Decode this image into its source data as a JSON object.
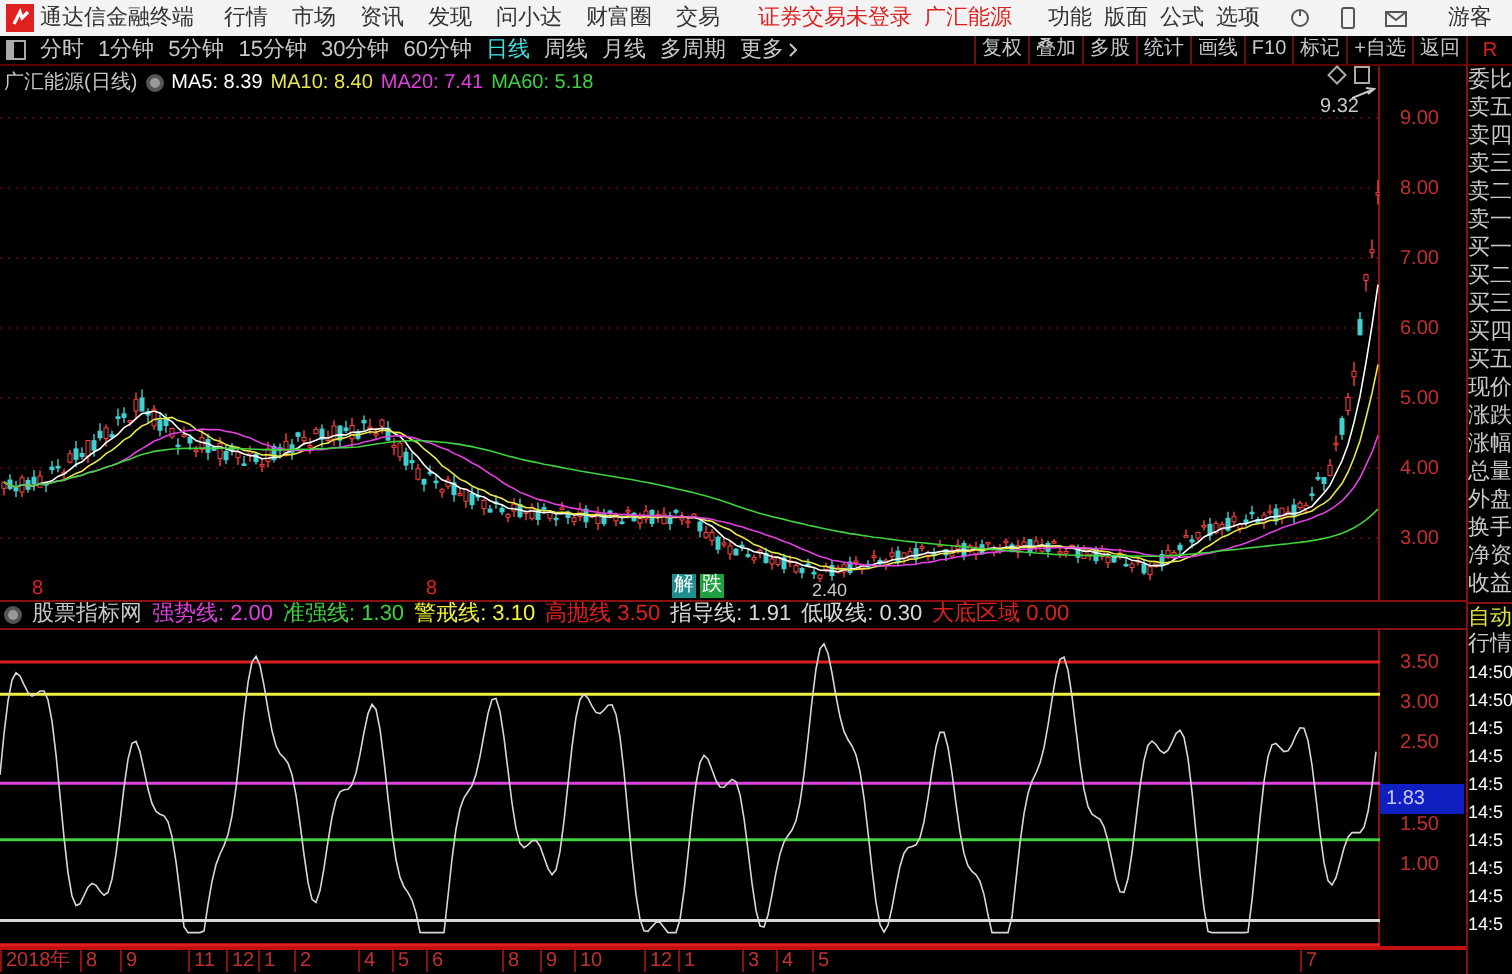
{
  "app_menu": {
    "title": "通达信金融终端",
    "items": [
      "行情",
      "市场",
      "资讯",
      "发现",
      "问小达",
      "财富圈",
      "交易"
    ],
    "notice": "证券交易未登录",
    "stock_link": "广汇能源",
    "tools": [
      "功能",
      "版面",
      "公式",
      "选项"
    ],
    "user": "游客"
  },
  "period_tabs": [
    {
      "label": "分时",
      "selected": false
    },
    {
      "label": "1分钟",
      "selected": false
    },
    {
      "label": "5分钟",
      "selected": false
    },
    {
      "label": "15分钟",
      "selected": false
    },
    {
      "label": "30分钟",
      "selected": false
    },
    {
      "label": "60分钟",
      "selected": false
    },
    {
      "label": "日线",
      "selected": true
    },
    {
      "label": "周线",
      "selected": false
    },
    {
      "label": "月线",
      "selected": false
    },
    {
      "label": "多周期",
      "selected": false
    },
    {
      "label": "更多",
      "selected": false
    }
  ],
  "chart_tools": [
    "复权",
    "叠加",
    "多股",
    "统计",
    "画线",
    "F10",
    "标记",
    "+自选",
    "返回"
  ],
  "corner_mark": "R",
  "price_chart": {
    "title": "广汇能源(日线)",
    "ma": [
      {
        "label": "MA5: 8.39",
        "color": "#ffffff"
      },
      {
        "label": "MA10: 8.40",
        "color": "#e8e84a"
      },
      {
        "label": "MA20: 7.41",
        "color": "#e040e0"
      },
      {
        "label": "MA60: 5.18",
        "color": "#40d040"
      }
    ],
    "high_label": "9.32",
    "low_label": "2.40",
    "axis": [
      "9.00",
      "8.00",
      "7.00",
      "6.00",
      "5.00",
      "4.00",
      "3.00"
    ],
    "markers": [
      "8",
      "8"
    ],
    "signals": [
      {
        "text": "解",
        "color": "#1f8f8f"
      },
      {
        "text": "跌",
        "color": "#1f9f3f"
      }
    ]
  },
  "indicator": {
    "title": "股票指标网",
    "current": "1.83",
    "axis": [
      "3.50",
      "3.00",
      "2.50",
      "1.50",
      "1.00"
    ],
    "lines": [
      {
        "label": "强势线:",
        "value": "2.00",
        "color": "#e040e0",
        "kind": "level"
      },
      {
        "label": "准强线:",
        "value": "1.30",
        "color": "#40d040",
        "kind": "level"
      },
      {
        "label": "警戒线:",
        "value": "3.10",
        "color": "#f0f040",
        "kind": "level"
      },
      {
        "label": "高抛线",
        "value": "3.50",
        "color": "#e02020",
        "kind": "level"
      },
      {
        "label": "指导线:",
        "value": "1.91",
        "color": "#d8d8d8",
        "kind": "curve"
      },
      {
        "label": "低吸线:",
        "value": "0.30",
        "color": "#d8d8d8",
        "kind": "level"
      },
      {
        "label": "大底区域",
        "value": "0.00",
        "color": "#e02020",
        "kind": "level"
      }
    ]
  },
  "dates": [
    "2018年",
    "8",
    "9",
    "11",
    "12",
    "1",
    "2",
    "4",
    "5",
    "6",
    "8",
    "9",
    "10",
    "12",
    "1",
    "3",
    "4",
    "5",
    "7"
  ],
  "quote_panel": {
    "labels": [
      "委比",
      "卖五",
      "卖四",
      "卖三",
      "卖二",
      "卖一",
      "买一",
      "买二",
      "买三",
      "买四",
      "买五",
      "现价",
      "涨跌",
      "涨幅",
      "总量",
      "外盘",
      "换手",
      "净资",
      "收益"
    ],
    "mode": "自动",
    "tab": "行情",
    "times": [
      "14:50",
      "14:50",
      "14:5",
      "14:5",
      "14:5",
      "14:5",
      "14:5",
      "14:5",
      "14:5",
      "14:5"
    ]
  }
}
